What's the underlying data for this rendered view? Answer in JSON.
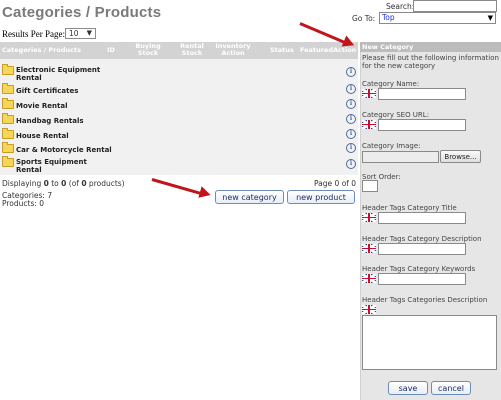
{
  "header": {
    "title": "Categories / Products",
    "search_label": "Search:",
    "search_value": "",
    "goto_label": "Go To:",
    "goto_value": "Top"
  },
  "results_per_page": {
    "label": "Results Per Page:",
    "value": "10"
  },
  "table": {
    "headers": {
      "name": "Categories / Products",
      "id": "ID",
      "buying": "Buying Stock",
      "rental": "Rental Stock",
      "inventory": "Inventory Action",
      "status": "Status",
      "featured": "Featured",
      "action": "Action"
    },
    "rows": [
      {
        "name": "Electronic Equipment Rental"
      },
      {
        "name": "Gift Certificates"
      },
      {
        "name": "Movie Rental"
      },
      {
        "name": "Handbag Rentals"
      },
      {
        "name": "House Rental"
      },
      {
        "name": "Car & Motorcycle Rental"
      },
      {
        "name": "Sports Equipment Rental"
      }
    ],
    "info_icon_glyph": "i"
  },
  "footer": {
    "displaying_prefix": "Displaying ",
    "from": "0",
    "to_word": " to ",
    "to": "0",
    "of_prefix": " (of ",
    "total": "0",
    "of_suffix": " products)",
    "page": "Page 0 of 0",
    "categories": "Categories: 7",
    "products": "Products: 0",
    "new_category_button": "new category",
    "new_product_button": "new product"
  },
  "panel": {
    "title": "New Category",
    "intro": "Please fill out the following information for the new category",
    "category_name_label": "Category Name:",
    "category_seo_label": "Category SEO URL:",
    "category_image_label": "Category Image:",
    "browse_button": "Browse...",
    "sort_order_label": "Sort Order:",
    "tags_title_label": "Header Tags Category Title",
    "tags_description_label": "Header Tags Category Description",
    "tags_keywords_label": "Header Tags Category Keywords",
    "tags_categories_description_label": "Header Tags Categories Description",
    "save_button": "save",
    "cancel_button": "cancel"
  },
  "colors": {
    "annotation_arrow": "#c0161b",
    "header_bg": "#d3d3d3",
    "panel_bg": "#e6e6e6"
  }
}
